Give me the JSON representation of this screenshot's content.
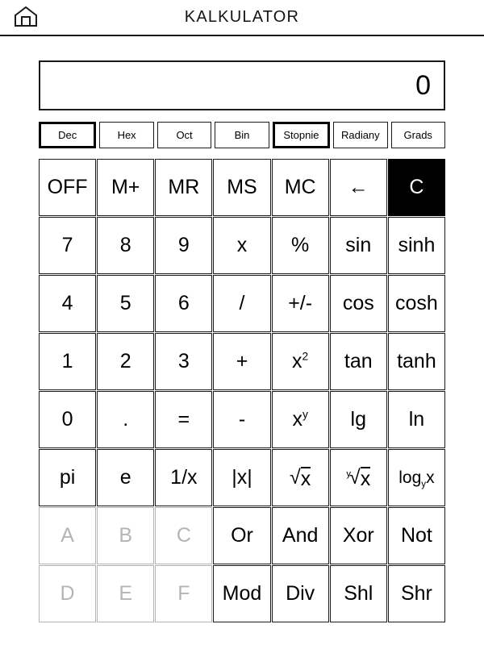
{
  "header": {
    "title": "KALKULATOR",
    "home_icon": "home-icon"
  },
  "display": {
    "value": "0"
  },
  "modes": [
    {
      "label": "Dec",
      "selected": true,
      "group": "base"
    },
    {
      "label": "Hex",
      "selected": false,
      "group": "base"
    },
    {
      "label": "Oct",
      "selected": false,
      "group": "base"
    },
    {
      "label": "Bin",
      "selected": false,
      "group": "base"
    },
    {
      "label": "Stopnie",
      "selected": true,
      "group": "angle"
    },
    {
      "label": "Radiany",
      "selected": false,
      "group": "angle"
    },
    {
      "label": "Grads",
      "selected": false,
      "group": "angle"
    }
  ],
  "keypad": {
    "rows": [
      [
        {
          "name": "off",
          "label": "OFF",
          "style": "normal",
          "size": "normal"
        },
        {
          "name": "memory-add",
          "label": "M+",
          "style": "normal",
          "size": "normal"
        },
        {
          "name": "memory-recall",
          "label": "MR",
          "style": "normal",
          "size": "normal"
        },
        {
          "name": "memory-store",
          "label": "MS",
          "style": "normal",
          "size": "normal"
        },
        {
          "name": "memory-clear",
          "label": "MC",
          "style": "normal",
          "size": "normal"
        },
        {
          "name": "backspace",
          "label": "←",
          "style": "normal",
          "size": "normal"
        },
        {
          "name": "clear",
          "label": "C",
          "style": "inverted",
          "size": "normal"
        }
      ],
      [
        {
          "name": "digit-7",
          "label": "7",
          "style": "normal",
          "size": "normal"
        },
        {
          "name": "digit-8",
          "label": "8",
          "style": "normal",
          "size": "normal"
        },
        {
          "name": "digit-9",
          "label": "9",
          "style": "normal",
          "size": "normal"
        },
        {
          "name": "multiply",
          "label": "x",
          "style": "normal",
          "size": "normal"
        },
        {
          "name": "percent",
          "label": "%",
          "style": "normal",
          "size": "normal"
        },
        {
          "name": "sin",
          "label": "sin",
          "style": "normal",
          "size": "normal"
        },
        {
          "name": "sinh",
          "label": "sinh",
          "style": "normal",
          "size": "normal"
        }
      ],
      [
        {
          "name": "digit-4",
          "label": "4",
          "style": "normal",
          "size": "normal"
        },
        {
          "name": "digit-5",
          "label": "5",
          "style": "normal",
          "size": "normal"
        },
        {
          "name": "digit-6",
          "label": "6",
          "style": "normal",
          "size": "normal"
        },
        {
          "name": "divide",
          "label": "/",
          "style": "normal",
          "size": "normal"
        },
        {
          "name": "sign-toggle",
          "label": "+/-",
          "style": "normal",
          "size": "normal"
        },
        {
          "name": "cos",
          "label": "cos",
          "style": "normal",
          "size": "normal"
        },
        {
          "name": "cosh",
          "label": "cosh",
          "style": "normal",
          "size": "normal"
        }
      ],
      [
        {
          "name": "digit-1",
          "label": "1",
          "style": "normal",
          "size": "normal"
        },
        {
          "name": "digit-2",
          "label": "2",
          "style": "normal",
          "size": "normal"
        },
        {
          "name": "digit-3",
          "label": "3",
          "style": "normal",
          "size": "normal"
        },
        {
          "name": "plus",
          "label": "+",
          "style": "normal",
          "size": "normal"
        },
        {
          "name": "square",
          "label": "x2",
          "style": "sup",
          "base": "x",
          "exp": "2",
          "size": "normal"
        },
        {
          "name": "tan",
          "label": "tan",
          "style": "normal",
          "size": "normal"
        },
        {
          "name": "tanh",
          "label": "tanh",
          "style": "normal",
          "size": "normal"
        }
      ],
      [
        {
          "name": "digit-0",
          "label": "0",
          "style": "normal",
          "size": "normal"
        },
        {
          "name": "decimal-point",
          "label": ".",
          "style": "normal",
          "size": "normal"
        },
        {
          "name": "equals",
          "label": "=",
          "style": "normal",
          "size": "normal"
        },
        {
          "name": "minus",
          "label": "-",
          "style": "normal",
          "size": "normal"
        },
        {
          "name": "power-xy",
          "label": "xy",
          "style": "sup",
          "base": "x",
          "exp": "y",
          "size": "normal"
        },
        {
          "name": "log10",
          "label": "lg",
          "style": "normal",
          "size": "normal"
        },
        {
          "name": "ln",
          "label": "ln",
          "style": "normal",
          "size": "normal"
        }
      ],
      [
        {
          "name": "pi",
          "label": "pi",
          "style": "normal",
          "size": "normal"
        },
        {
          "name": "euler-e",
          "label": "e",
          "style": "normal",
          "size": "normal"
        },
        {
          "name": "reciprocal",
          "label": "1/x",
          "style": "normal",
          "size": "normal"
        },
        {
          "name": "absolute",
          "label": "|x|",
          "style": "normal",
          "size": "normal"
        },
        {
          "name": "square-root",
          "label": "√x",
          "style": "radical",
          "index": "",
          "radicand": "x",
          "size": "normal"
        },
        {
          "name": "nth-root",
          "label": "y√x",
          "style": "radical",
          "index": "y",
          "radicand": "x",
          "size": "normal"
        },
        {
          "name": "log-base-y",
          "label": "logyx",
          "style": "sub",
          "base": "log",
          "sub": "y",
          "tail": "x",
          "size": "small"
        }
      ],
      [
        {
          "name": "hex-a",
          "label": "A",
          "style": "disabled",
          "size": "normal"
        },
        {
          "name": "hex-b",
          "label": "B",
          "style": "disabled",
          "size": "normal"
        },
        {
          "name": "hex-c",
          "label": "C",
          "style": "disabled",
          "size": "normal"
        },
        {
          "name": "bitwise-or",
          "label": "Or",
          "style": "normal",
          "size": "normal"
        },
        {
          "name": "bitwise-and",
          "label": "And",
          "style": "normal",
          "size": "normal"
        },
        {
          "name": "bitwise-xor",
          "label": "Xor",
          "style": "normal",
          "size": "normal"
        },
        {
          "name": "bitwise-not",
          "label": "Not",
          "style": "normal",
          "size": "normal"
        }
      ],
      [
        {
          "name": "hex-d",
          "label": "D",
          "style": "disabled",
          "size": "normal"
        },
        {
          "name": "hex-e",
          "label": "E",
          "style": "disabled",
          "size": "normal"
        },
        {
          "name": "hex-f",
          "label": "F",
          "style": "disabled",
          "size": "normal"
        },
        {
          "name": "modulo",
          "label": "Mod",
          "style": "normal",
          "size": "normal"
        },
        {
          "name": "integer-div",
          "label": "Div",
          "style": "normal",
          "size": "normal"
        },
        {
          "name": "shift-left",
          "label": "Shl",
          "style": "normal",
          "size": "normal"
        },
        {
          "name": "shift-right",
          "label": "Shr",
          "style": "normal",
          "size": "normal"
        }
      ]
    ]
  },
  "colors": {
    "border": "#1a1a1a",
    "disabled": "#b4b4b4",
    "inverted_bg": "#000000",
    "background": "#ffffff"
  }
}
